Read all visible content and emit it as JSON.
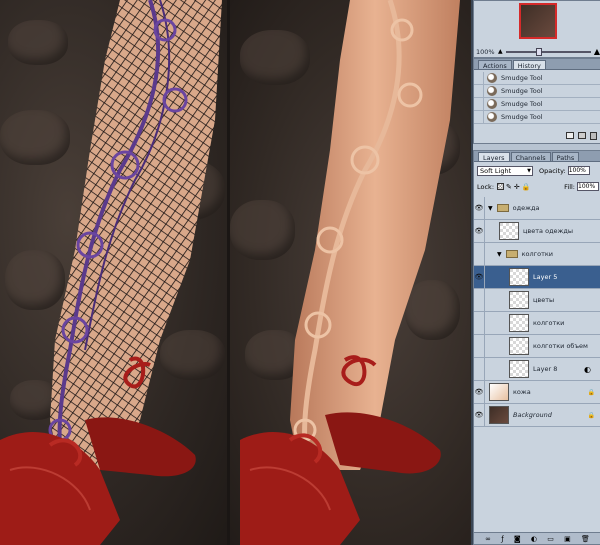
{
  "navigator": {
    "zoom": "100%"
  },
  "history_panel": {
    "tabs": [
      "Actions",
      "History"
    ],
    "active_tab": "History",
    "items": [
      "Smudge Tool",
      "Smudge Tool",
      "Smudge Tool",
      "Smudge Tool"
    ]
  },
  "layers_panel": {
    "tabs": [
      "Layers",
      "Channels",
      "Paths"
    ],
    "active_tab": "Layers",
    "blend_mode": "Soft Light",
    "opacity_label": "Opacity:",
    "opacity_value": "100%",
    "lock_label": "Lock:",
    "fill_label": "Fill:",
    "fill_value": "100%",
    "layers": [
      {
        "name": "одежда",
        "kind": "group",
        "visible": true
      },
      {
        "name": "цвета одежды",
        "kind": "layer",
        "visible": true
      },
      {
        "name": "колготки",
        "kind": "group",
        "visible": false
      },
      {
        "name": "Layer 5",
        "kind": "layer",
        "visible": true,
        "selected": true
      },
      {
        "name": "цветы",
        "kind": "layer",
        "visible": false
      },
      {
        "name": "колготки",
        "kind": "layer",
        "visible": false
      },
      {
        "name": "колготки объем",
        "kind": "layer",
        "visible": false
      },
      {
        "name": "Layer 8",
        "kind": "layer",
        "visible": false
      },
      {
        "name": "кожа",
        "kind": "layer",
        "visible": true
      },
      {
        "name": "Background",
        "kind": "layer",
        "visible": true
      }
    ]
  },
  "colors": {
    "panel_bg": "#c9d3de",
    "selected": "#3a5f8f",
    "shoe_red": "#9e1c17",
    "lace_purple": "#5b3a8c",
    "skin": "#d9a078"
  }
}
